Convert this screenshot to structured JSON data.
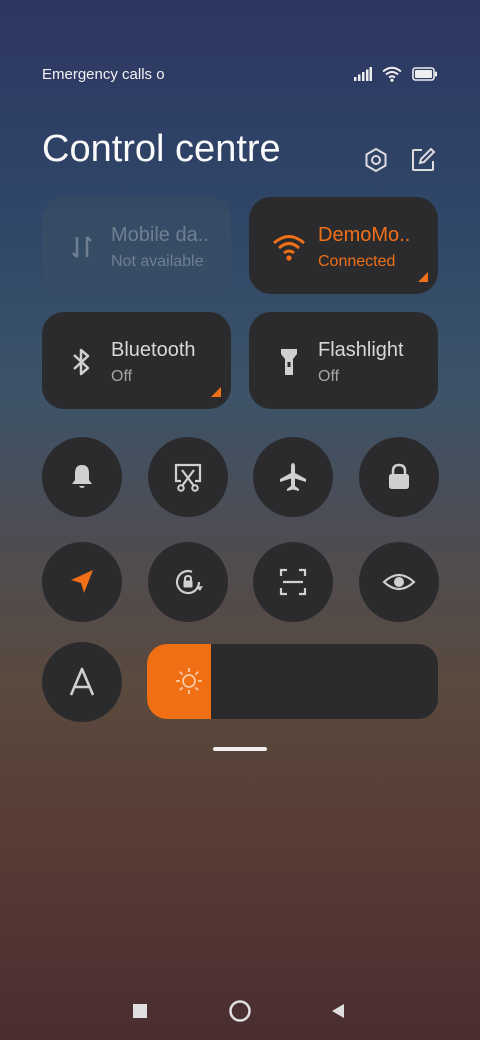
{
  "status_bar": {
    "carrier_text": "Emergency calls o"
  },
  "header": {
    "title": "Control centre"
  },
  "tiles": {
    "mobile_data": {
      "label": "Mobile da..",
      "sub": "Not available"
    },
    "wifi": {
      "label": "DemoMo..",
      "sub": "Connected"
    },
    "bluetooth": {
      "label": "Bluetooth",
      "sub": "Off"
    },
    "flashlight": {
      "label": "Flashlight",
      "sub": "Off"
    }
  },
  "toggles_row1": [
    "bell-icon",
    "screenshot-scissors-icon",
    "airplane-icon",
    "lock-icon"
  ],
  "toggles_row2": [
    "location-arrow-icon",
    "auto-rotate-lock-icon",
    "scan-icon",
    "eye-icon"
  ],
  "brightness": {
    "level_fraction": 0.22
  },
  "colors": {
    "accent": "#f07018",
    "tile_bg": "#2b2b2e",
    "icon_gray": "#d0d0d0"
  },
  "nav_bar": [
    "recents-square-icon",
    "home-circle-icon",
    "back-triangle-icon"
  ]
}
